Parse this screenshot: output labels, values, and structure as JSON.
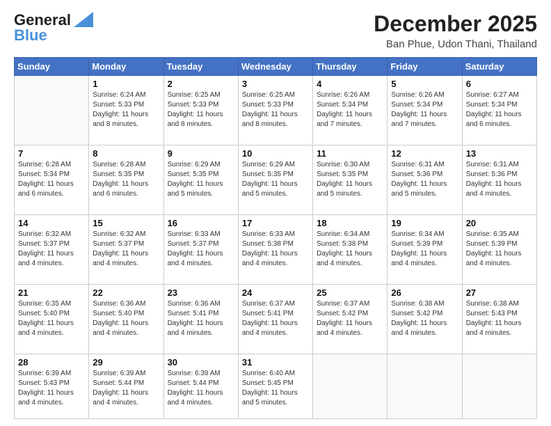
{
  "logo": {
    "line1": "General",
    "line2": "Blue"
  },
  "title": "December 2025",
  "location": "Ban Phue, Udon Thani, Thailand",
  "days_of_week": [
    "Sunday",
    "Monday",
    "Tuesday",
    "Wednesday",
    "Thursday",
    "Friday",
    "Saturday"
  ],
  "weeks": [
    [
      {
        "day": "",
        "empty": true
      },
      {
        "day": "1",
        "sunrise": "6:24 AM",
        "sunset": "5:33 PM",
        "daylight": "11 hours and 8 minutes."
      },
      {
        "day": "2",
        "sunrise": "6:25 AM",
        "sunset": "5:33 PM",
        "daylight": "11 hours and 8 minutes."
      },
      {
        "day": "3",
        "sunrise": "6:25 AM",
        "sunset": "5:33 PM",
        "daylight": "11 hours and 8 minutes."
      },
      {
        "day": "4",
        "sunrise": "6:26 AM",
        "sunset": "5:34 PM",
        "daylight": "11 hours and 7 minutes."
      },
      {
        "day": "5",
        "sunrise": "6:26 AM",
        "sunset": "5:34 PM",
        "daylight": "11 hours and 7 minutes."
      },
      {
        "day": "6",
        "sunrise": "6:27 AM",
        "sunset": "5:34 PM",
        "daylight": "11 hours and 6 minutes."
      }
    ],
    [
      {
        "day": "7",
        "sunrise": "6:28 AM",
        "sunset": "5:34 PM",
        "daylight": "11 hours and 6 minutes."
      },
      {
        "day": "8",
        "sunrise": "6:28 AM",
        "sunset": "5:35 PM",
        "daylight": "11 hours and 6 minutes."
      },
      {
        "day": "9",
        "sunrise": "6:29 AM",
        "sunset": "5:35 PM",
        "daylight": "11 hours and 5 minutes."
      },
      {
        "day": "10",
        "sunrise": "6:29 AM",
        "sunset": "5:35 PM",
        "daylight": "11 hours and 5 minutes."
      },
      {
        "day": "11",
        "sunrise": "6:30 AM",
        "sunset": "5:35 PM",
        "daylight": "11 hours and 5 minutes."
      },
      {
        "day": "12",
        "sunrise": "6:31 AM",
        "sunset": "5:36 PM",
        "daylight": "11 hours and 5 minutes."
      },
      {
        "day": "13",
        "sunrise": "6:31 AM",
        "sunset": "5:36 PM",
        "daylight": "11 hours and 4 minutes."
      }
    ],
    [
      {
        "day": "14",
        "sunrise": "6:32 AM",
        "sunset": "5:37 PM",
        "daylight": "11 hours and 4 minutes."
      },
      {
        "day": "15",
        "sunrise": "6:32 AM",
        "sunset": "5:37 PM",
        "daylight": "11 hours and 4 minutes."
      },
      {
        "day": "16",
        "sunrise": "6:33 AM",
        "sunset": "5:37 PM",
        "daylight": "11 hours and 4 minutes."
      },
      {
        "day": "17",
        "sunrise": "6:33 AM",
        "sunset": "5:38 PM",
        "daylight": "11 hours and 4 minutes."
      },
      {
        "day": "18",
        "sunrise": "6:34 AM",
        "sunset": "5:38 PM",
        "daylight": "11 hours and 4 minutes."
      },
      {
        "day": "19",
        "sunrise": "6:34 AM",
        "sunset": "5:39 PM",
        "daylight": "11 hours and 4 minutes."
      },
      {
        "day": "20",
        "sunrise": "6:35 AM",
        "sunset": "5:39 PM",
        "daylight": "11 hours and 4 minutes."
      }
    ],
    [
      {
        "day": "21",
        "sunrise": "6:35 AM",
        "sunset": "5:40 PM",
        "daylight": "11 hours and 4 minutes."
      },
      {
        "day": "22",
        "sunrise": "6:36 AM",
        "sunset": "5:40 PM",
        "daylight": "11 hours and 4 minutes."
      },
      {
        "day": "23",
        "sunrise": "6:36 AM",
        "sunset": "5:41 PM",
        "daylight": "11 hours and 4 minutes."
      },
      {
        "day": "24",
        "sunrise": "6:37 AM",
        "sunset": "5:41 PM",
        "daylight": "11 hours and 4 minutes."
      },
      {
        "day": "25",
        "sunrise": "6:37 AM",
        "sunset": "5:42 PM",
        "daylight": "11 hours and 4 minutes."
      },
      {
        "day": "26",
        "sunrise": "6:38 AM",
        "sunset": "5:42 PM",
        "daylight": "11 hours and 4 minutes."
      },
      {
        "day": "27",
        "sunrise": "6:38 AM",
        "sunset": "5:43 PM",
        "daylight": "11 hours and 4 minutes."
      }
    ],
    [
      {
        "day": "28",
        "sunrise": "6:39 AM",
        "sunset": "5:43 PM",
        "daylight": "11 hours and 4 minutes."
      },
      {
        "day": "29",
        "sunrise": "6:39 AM",
        "sunset": "5:44 PM",
        "daylight": "11 hours and 4 minutes."
      },
      {
        "day": "30",
        "sunrise": "6:39 AM",
        "sunset": "5:44 PM",
        "daylight": "11 hours and 4 minutes."
      },
      {
        "day": "31",
        "sunrise": "6:40 AM",
        "sunset": "5:45 PM",
        "daylight": "11 hours and 5 minutes."
      },
      {
        "day": "",
        "empty": true
      },
      {
        "day": "",
        "empty": true
      },
      {
        "day": "",
        "empty": true
      }
    ]
  ],
  "labels": {
    "sunrise": "Sunrise:",
    "sunset": "Sunset:",
    "daylight": "Daylight:"
  }
}
